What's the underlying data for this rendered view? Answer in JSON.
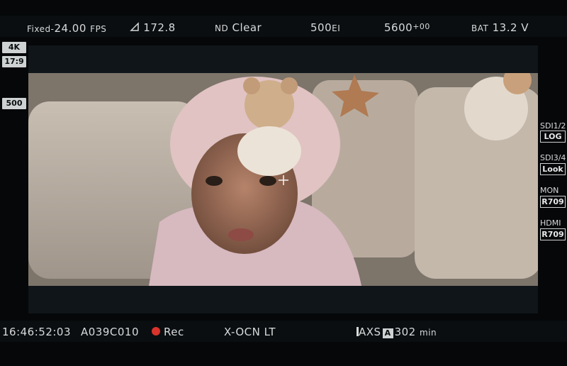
{
  "top_bar": {
    "fps_prefix": "Fixed-",
    "fps_value": "24.00",
    "fps_unit": "FPS",
    "shutter": "172.8",
    "nd_prefix": "ND",
    "nd_value": "Clear",
    "ei_value": "500",
    "ei_unit": "EI",
    "wb_value": "5600",
    "wb_tint": "+00",
    "battery_label": "BAT",
    "battery_value": "13.2 V"
  },
  "left_badges": {
    "resolution": "4K",
    "aspect": "17:9",
    "ei_badge": "500"
  },
  "right_outputs": [
    {
      "label": "SDI1/2",
      "value": "LOG"
    },
    {
      "label": "SDI3/4",
      "value": "Look"
    },
    {
      "label": "MON",
      "value": "R709"
    },
    {
      "label": "HDMI",
      "value": "R709"
    }
  ],
  "bottom_bar": {
    "timecode": "16:46:52:03",
    "clip_name": "A039C010",
    "rec_label": "Rec",
    "codec": "X-OCN LT",
    "media_prefix": "AXS",
    "media_slot": "A",
    "remaining_value": "302",
    "remaining_unit": "min"
  },
  "colors": {
    "background": "#050708",
    "bar": "#0a0e10",
    "text": "#d8dadb",
    "rec": "#d9332b"
  },
  "icons": [
    "shutter-angle-icon",
    "crosshair-icon",
    "rec-dot-icon",
    "media-bar-icon"
  ]
}
